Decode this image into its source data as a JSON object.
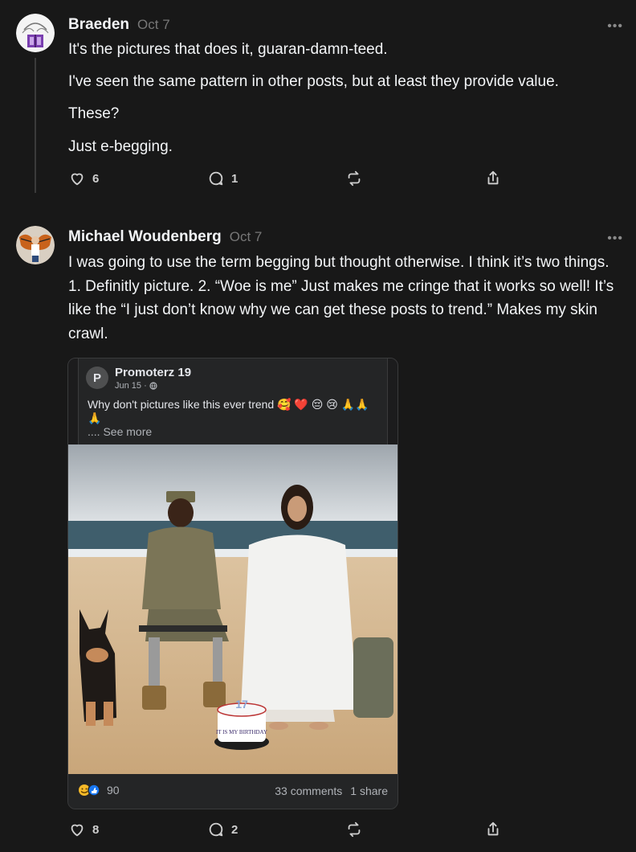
{
  "posts": [
    {
      "author": "Braeden",
      "time": "Oct 7",
      "more": "•••",
      "paragraphs": [
        "It's the pictures that does it, guaran-damn-teed.",
        "I've seen the same pattern in other posts, but at least they provide value.",
        "These?",
        "Just e-begging."
      ],
      "likes": "6",
      "replies": "1"
    },
    {
      "author": "Michael Woudenberg",
      "time": "Oct 7",
      "more": "•••",
      "body": "I was going to use the term begging but thought otherwise. I think it’s two things. 1. Definitly picture. 2. “Woe is me” Just makes me cringe that it works so well! It’s like the “I just don’t know why we can get these posts to trend.” Makes my skin crawl.",
      "likes": "8",
      "replies": "2",
      "embed": {
        "page_initial": "P",
        "page_name": "Promoterz 19",
        "date": "Jun 15 ·",
        "text": "Why don't pictures like this ever trend 🥰 ❤️ 😔 😢 🙏🙏🙏",
        "see_more": ".... See more",
        "reactions": "90",
        "comments": "33 comments",
        "shares": "1 share",
        "photo_cake_text": "IT IS MY BIRTHDAY",
        "photo_cake_number": "17"
      }
    }
  ],
  "icons": {
    "like": "heart-icon",
    "reply": "comment-icon",
    "repost": "repost-icon",
    "share": "share-icon"
  },
  "colors": {
    "background": "#181818",
    "text": "#f3f5f7",
    "muted": "#777777"
  }
}
